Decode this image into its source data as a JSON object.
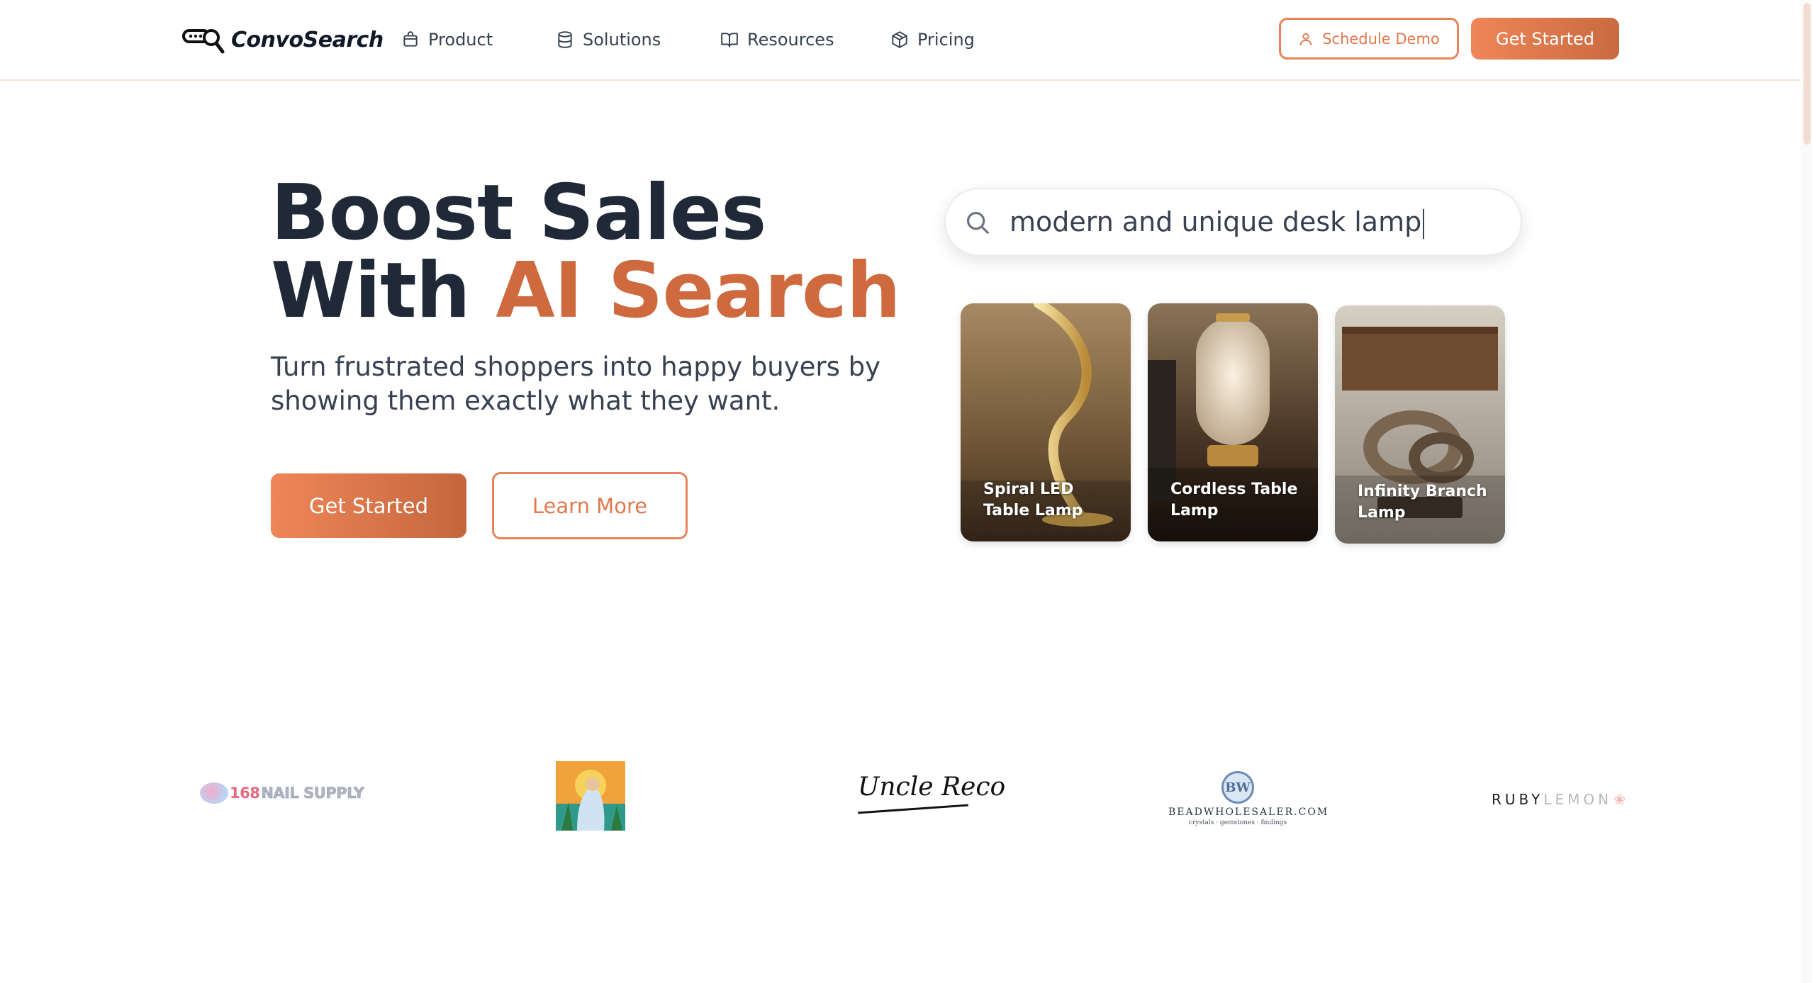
{
  "header": {
    "logo_text": "ConvoSearch",
    "nav": [
      {
        "label": "Product",
        "icon": "bag-icon"
      },
      {
        "label": "Solutions",
        "icon": "database-icon"
      },
      {
        "label": "Resources",
        "icon": "book-icon"
      },
      {
        "label": "Pricing",
        "icon": "cube-icon"
      }
    ],
    "schedule_demo_label": "Schedule Demo",
    "get_started_label": "Get Started"
  },
  "hero": {
    "headline_line1": "Boost Sales",
    "headline_line2_dark": "With",
    "headline_line2_accent": "AI Search",
    "subhead": "Turn frustrated shoppers into happy buyers by showing them exactly what they want.",
    "primary_cta": "Get Started",
    "secondary_cta": "Learn More"
  },
  "search": {
    "value": "modern and unique desk lamp"
  },
  "results": [
    {
      "title": "Spiral LED Table Lamp"
    },
    {
      "title": "Cordless Table Lamp"
    },
    {
      "title": "Infinity Branch Lamp"
    }
  ],
  "brands": {
    "nail_supply_num": "168",
    "nail_supply_text": "NAIL SUPPLY",
    "uncle_text": "Uncle Reco",
    "bead_initials": "BW",
    "bead_name": "BEADWHOLESALER.COM",
    "bead_tagline": "crystals · gemstones · findings",
    "ruby_part1": "RUBY",
    "ruby_part2": "LEMON"
  },
  "colors": {
    "accent": "#cf6a3f",
    "button_gradient_start": "#ef8658",
    "button_gradient_end": "#c4663d",
    "heading": "#1f2937"
  }
}
